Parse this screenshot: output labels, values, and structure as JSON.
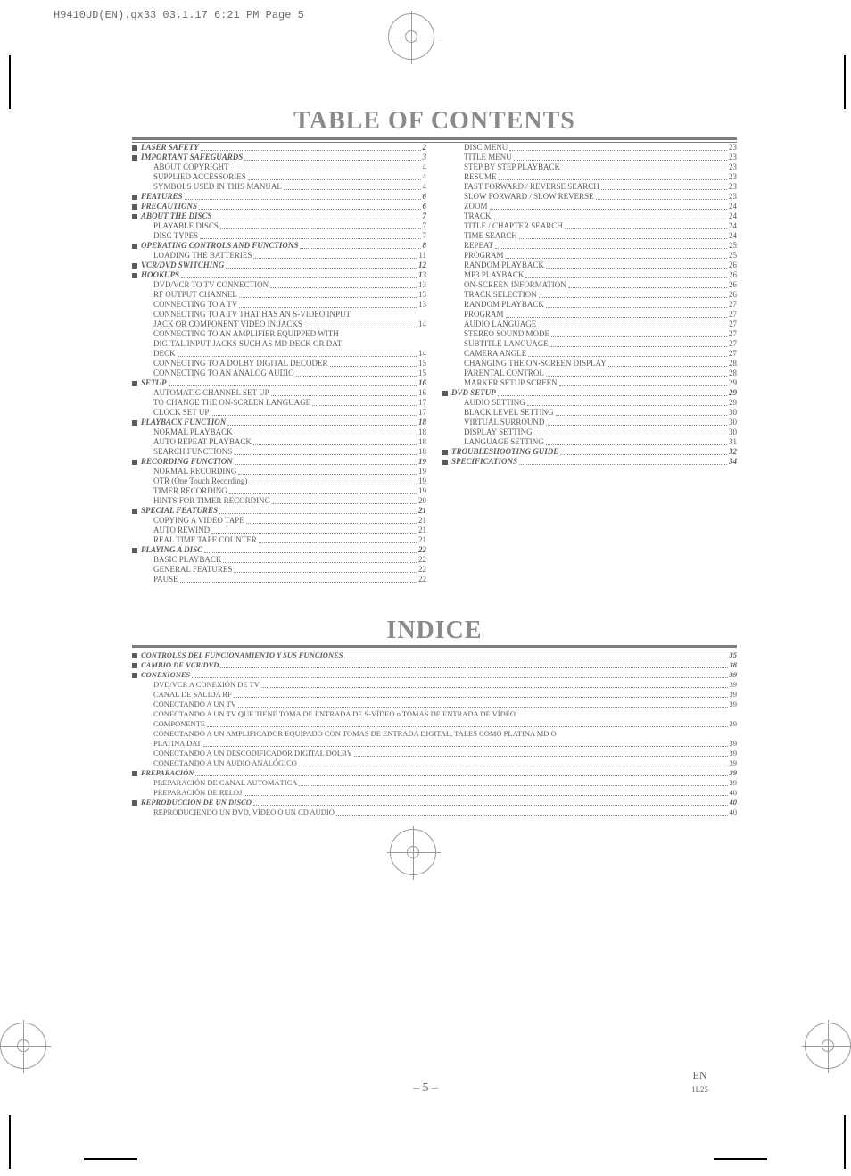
{
  "header_text": "H9410UD(EN).qx33  03.1.17 6:21 PM  Page 5",
  "title_toc": "TABLE OF CONTENTS",
  "title_indice": "INDICE",
  "footer_page": "– 5 –",
  "footer_lang": "EN",
  "footer_code": "1L25",
  "toc_left": [
    {
      "t": "section",
      "label": "LASER SAFETY",
      "pg": "2"
    },
    {
      "t": "section",
      "label": "IMPORTANT SAFEGUARDS",
      "pg": "3"
    },
    {
      "t": "sub",
      "label": "ABOUT COPYRIGHT",
      "pg": "4"
    },
    {
      "t": "sub",
      "label": "SUPPLIED ACCESSORIES",
      "pg": "4"
    },
    {
      "t": "sub",
      "label": "SYMBOLS USED IN THIS MANUAL",
      "pg": "4"
    },
    {
      "t": "section",
      "label": "FEATURES",
      "pg": "6"
    },
    {
      "t": "section",
      "label": "PRECAUTIONS",
      "pg": "6"
    },
    {
      "t": "section",
      "label": "ABOUT THE DISCS",
      "pg": "7"
    },
    {
      "t": "sub",
      "label": "PLAYABLE DISCS",
      "pg": "7"
    },
    {
      "t": "sub",
      "label": "DISC TYPES",
      "pg": "7"
    },
    {
      "t": "section",
      "label": "OPERATING CONTROLS AND FUNCTIONS",
      "pg": "8"
    },
    {
      "t": "sub",
      "label": "LOADING THE BATTERIES",
      "pg": "11"
    },
    {
      "t": "section",
      "label": "VCR/DVD SWITCHING",
      "pg": "12"
    },
    {
      "t": "section",
      "label": "HOOKUPS",
      "pg": "13"
    },
    {
      "t": "sub",
      "label": "DVD/VCR TO TV CONNECTION",
      "pg": "13"
    },
    {
      "t": "sub",
      "label": "RF OUTPUT CHANNEL",
      "pg": "13"
    },
    {
      "t": "sub",
      "label": "CONNECTING TO A TV",
      "pg": "13"
    },
    {
      "t": "sub",
      "label": "CONNECTING TO A TV THAT HAS AN S-VIDEO INPUT",
      "pg": ""
    },
    {
      "t": "sub",
      "label": "JACK OR COMPONENT VIDEO IN JACKS",
      "pg": "14"
    },
    {
      "t": "sub",
      "label": "CONNECTING TO AN AMPLIFIER EQUIPPED WITH",
      "pg": ""
    },
    {
      "t": "sub",
      "label": "DIGITAL INPUT JACKS SUCH AS MD DECK OR DAT",
      "pg": ""
    },
    {
      "t": "sub",
      "label": "DECK",
      "pg": "14"
    },
    {
      "t": "sub",
      "label": "CONNECTING TO A DOLBY DIGITAL DECODER",
      "pg": "15"
    },
    {
      "t": "sub",
      "label": "CONNECTING TO AN ANALOG AUDIO",
      "pg": "15"
    },
    {
      "t": "section",
      "label": "SETUP",
      "pg": "16"
    },
    {
      "t": "sub",
      "label": "AUTOMATIC CHANNEL SET UP",
      "pg": "16"
    },
    {
      "t": "sub",
      "label": "TO CHANGE THE ON-SCREEN LANGUAGE",
      "pg": "17"
    },
    {
      "t": "sub",
      "label": "CLOCK SET UP",
      "pg": "17"
    },
    {
      "t": "section",
      "label": "PLAYBACK FUNCTION",
      "pg": "18"
    },
    {
      "t": "sub",
      "label": "NORMAL PLAYBACK",
      "pg": "18"
    },
    {
      "t": "sub",
      "label": "AUTO REPEAT PLAYBACK",
      "pg": "18"
    },
    {
      "t": "sub",
      "label": "SEARCH FUNCTIONS",
      "pg": "18"
    },
    {
      "t": "section",
      "label": "RECORDING FUNCTION",
      "pg": "19"
    },
    {
      "t": "sub",
      "label": "NORMAL RECORDING",
      "pg": "19"
    },
    {
      "t": "sub",
      "label": "OTR (One Touch Recording)",
      "pg": "19"
    },
    {
      "t": "sub",
      "label": "TIMER RECORDING",
      "pg": "19"
    },
    {
      "t": "sub",
      "label": "HINTS FOR TIMER RECORDING",
      "pg": "20"
    },
    {
      "t": "section",
      "label": "SPECIAL FEATURES",
      "pg": "21"
    },
    {
      "t": "sub",
      "label": "COPYING A VIDEO TAPE",
      "pg": "21"
    },
    {
      "t": "sub",
      "label": "AUTO REWIND",
      "pg": "21"
    },
    {
      "t": "sub",
      "label": "REAL TIME TAPE COUNTER",
      "pg": "21"
    },
    {
      "t": "section",
      "label": "PLAYING A DISC",
      "pg": "22"
    },
    {
      "t": "sub",
      "label": "BASIC PLAYBACK",
      "pg": "22"
    },
    {
      "t": "sub",
      "label": "GENERAL FEATURES",
      "pg": "22"
    },
    {
      "t": "sub",
      "label": "PAUSE",
      "pg": "22"
    }
  ],
  "toc_right": [
    {
      "t": "sub",
      "label": "DISC MENU",
      "pg": "23"
    },
    {
      "t": "sub",
      "label": "TITLE MENU",
      "pg": "23"
    },
    {
      "t": "sub",
      "label": "STEP BY STEP PLAYBACK",
      "pg": "23"
    },
    {
      "t": "sub",
      "label": "RESUME",
      "pg": "23"
    },
    {
      "t": "sub",
      "label": "FAST FORWARD / REVERSE SEARCH",
      "pg": "23"
    },
    {
      "t": "sub",
      "label": "SLOW FORWARD / SLOW REVERSE",
      "pg": "23"
    },
    {
      "t": "sub",
      "label": "ZOOM",
      "pg": "24"
    },
    {
      "t": "sub",
      "label": "TRACK",
      "pg": "24"
    },
    {
      "t": "sub",
      "label": "TITLE / CHAPTER SEARCH",
      "pg": "24"
    },
    {
      "t": "sub",
      "label": "TIME SEARCH",
      "pg": "24"
    },
    {
      "t": "sub",
      "label": "REPEAT",
      "pg": "25"
    },
    {
      "t": "sub",
      "label": "PROGRAM",
      "pg": "25"
    },
    {
      "t": "sub",
      "label": "RANDOM PLAYBACK",
      "pg": "26"
    },
    {
      "t": "sub",
      "label": "MP3 PLAYBACK",
      "pg": "26"
    },
    {
      "t": "sub",
      "label": "ON-SCREEN INFORMATION",
      "pg": "26"
    },
    {
      "t": "sub",
      "label": "TRACK SELECTION",
      "pg": "26"
    },
    {
      "t": "sub",
      "label": "RANDOM PLAYBACK",
      "pg": "27"
    },
    {
      "t": "sub",
      "label": "PROGRAM",
      "pg": "27"
    },
    {
      "t": "sub",
      "label": "AUDIO LANGUAGE",
      "pg": "27"
    },
    {
      "t": "sub",
      "label": "STEREO SOUND MODE",
      "pg": "27"
    },
    {
      "t": "sub",
      "label": "SUBTITLE LANGUAGE",
      "pg": "27"
    },
    {
      "t": "sub",
      "label": "CAMERA ANGLE",
      "pg": "27"
    },
    {
      "t": "sub",
      "label": "CHANGING THE ON-SCREEN DISPLAY",
      "pg": "28"
    },
    {
      "t": "sub",
      "label": "PARENTAL CONTROL",
      "pg": "28"
    },
    {
      "t": "sub",
      "label": "MARKER SETUP SCREEN",
      "pg": "29"
    },
    {
      "t": "section",
      "label": "DVD SETUP",
      "pg": "29"
    },
    {
      "t": "sub",
      "label": "AUDIO SETTING",
      "pg": "29"
    },
    {
      "t": "sub",
      "label": "BLACK LEVEL SETTING",
      "pg": "30"
    },
    {
      "t": "sub",
      "label": "VIRTUAL SURROUND",
      "pg": "30"
    },
    {
      "t": "sub",
      "label": "DISPLAY SETTING",
      "pg": "30"
    },
    {
      "t": "sub",
      "label": "LANGUAGE SETTING",
      "pg": "31"
    },
    {
      "t": "section",
      "label": "TROUBLESHOOTING GUIDE",
      "pg": "32"
    },
    {
      "t": "section",
      "label": "SPECIFICATIONS",
      "pg": "34"
    }
  ],
  "indice": [
    {
      "t": "section",
      "label": "CONTROLES DEL FUNCIONAMIENTO Y SUS FUNCIONES",
      "pg": "35"
    },
    {
      "t": "section",
      "label": "CAMBIO DE VCR/DVD",
      "pg": "38"
    },
    {
      "t": "section",
      "label": "CONEXIONES",
      "pg": "39"
    },
    {
      "t": "sub",
      "label": "DVD/VCR A CONEXIÓN DE TV",
      "pg": "39"
    },
    {
      "t": "sub",
      "label": "CANAL DE SALIDA RF",
      "pg": "39"
    },
    {
      "t": "sub",
      "label": "CONECTANDO A UN TV",
      "pg": "39"
    },
    {
      "t": "sub",
      "label": "CONECTANDO A UN TV QUE TIENE TOMA DE ENTRADA DE S-VÍDEO o TOMAS DE ENTRADA DE VÍDEO",
      "pg": ""
    },
    {
      "t": "sub",
      "label": "COMPONENTE",
      "pg": "39"
    },
    {
      "t": "sub",
      "label": "CONECTANDO A UN AMPLIFICADOR EQUIPADO CON TOMAS DE ENTRADA DIGITAL, TALES COMO PLATINA MD O",
      "pg": ""
    },
    {
      "t": "sub",
      "label": "PLATINA DAT",
      "pg": "39"
    },
    {
      "t": "sub",
      "label": "CONECTANDO A UN DESCODIFICADOR DIGITAL DOLBY",
      "pg": "39"
    },
    {
      "t": "sub",
      "label": "CONECTANDO A UN AUDIO ANALÓGICO",
      "pg": "39"
    },
    {
      "t": "section",
      "label": "PREPARACIÓN",
      "pg": "39"
    },
    {
      "t": "sub",
      "label": "PREPARACIÓN DE CANAL AUTOMÁTICA",
      "pg": "39"
    },
    {
      "t": "sub",
      "label": "PREPARACIÓN DE RELOJ",
      "pg": "40"
    },
    {
      "t": "section",
      "label": "REPRODUCCIÓN DE UN DISCO",
      "pg": "40"
    },
    {
      "t": "sub",
      "label": "REPRODUCIENDO UN DVD, VÍDEO O UN CD AUDIO",
      "pg": "40"
    }
  ]
}
